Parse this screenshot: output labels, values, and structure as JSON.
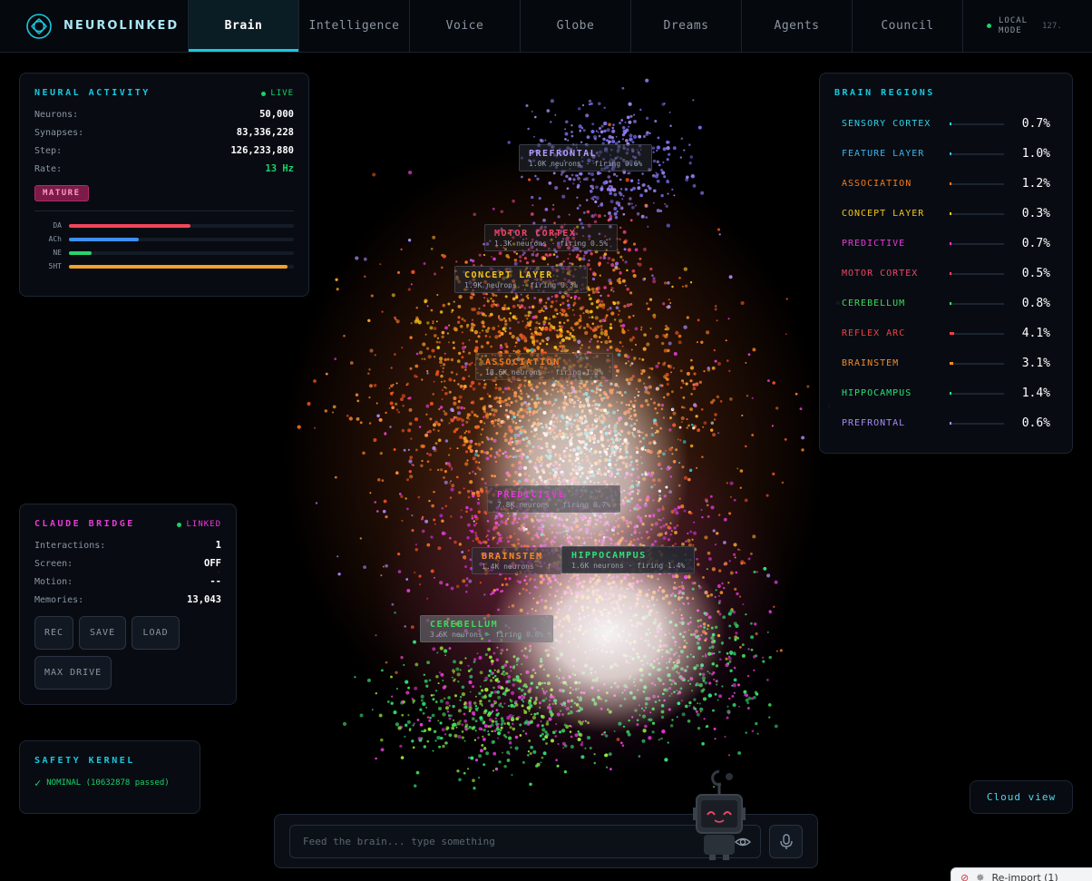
{
  "brand": {
    "name": "NEUROLINKED"
  },
  "nav": {
    "tabs": [
      {
        "label": "Brain",
        "active": true
      },
      {
        "label": "Intelligence"
      },
      {
        "label": "Voice"
      },
      {
        "label": "Globe"
      },
      {
        "label": "Dreams"
      },
      {
        "label": "Agents"
      },
      {
        "label": "Council"
      }
    ],
    "mode_label": "LOCAL MODE",
    "host": "127."
  },
  "neural_activity": {
    "title": "NEURAL ACTIVITY",
    "status": "LIVE",
    "stats": [
      {
        "label": "Neurons:",
        "value": "50,000"
      },
      {
        "label": "Synapses:",
        "value": "83,336,228"
      },
      {
        "label": "Step:",
        "value": "126,233,880"
      },
      {
        "label": "Rate:",
        "value": "13 Hz"
      }
    ],
    "badge": "MATURE",
    "neuromodulators": [
      {
        "label": "DA",
        "level": 0.54,
        "color": "#f0455a"
      },
      {
        "label": "ACh",
        "level": 0.31,
        "color": "#3f8ff5"
      },
      {
        "label": "NE",
        "level": 0.1,
        "color": "#27d36f"
      },
      {
        "label": "5HT",
        "level": 0.97,
        "color": "#f5a02b"
      }
    ]
  },
  "brain_regions": {
    "title": "BRAIN REGIONS",
    "items": [
      {
        "name": "SENSORY CORTEX",
        "pct": "0.7%",
        "value": 0.7,
        "color": "#2cd3ea"
      },
      {
        "name": "FEATURE LAYER",
        "pct": "1.0%",
        "value": 1.0,
        "color": "#38b6f0"
      },
      {
        "name": "ASSOCIATION",
        "pct": "1.2%",
        "value": 1.2,
        "color": "#f57a1f"
      },
      {
        "name": "CONCEPT LAYER",
        "pct": "0.3%",
        "value": 0.3,
        "color": "#f5c518"
      },
      {
        "name": "PREDICTIVE",
        "pct": "0.7%",
        "value": 0.7,
        "color": "#e83ad8"
      },
      {
        "name": "MOTOR CORTEX",
        "pct": "0.5%",
        "value": 0.5,
        "color": "#f0456a"
      },
      {
        "name": "CEREBELLUM",
        "pct": "0.8%",
        "value": 0.8,
        "color": "#3ddc5a"
      },
      {
        "name": "REFLEX ARC",
        "pct": "4.1%",
        "value": 4.1,
        "color": "#f04040"
      },
      {
        "name": "BRAINSTEM",
        "pct": "3.1%",
        "value": 3.1,
        "color": "#f58a2a"
      },
      {
        "name": "HIPPOCAMPUS",
        "pct": "1.4%",
        "value": 1.4,
        "color": "#2ee07a"
      },
      {
        "name": "PREFRONTAL",
        "pct": "0.6%",
        "value": 0.6,
        "color": "#a98af5"
      }
    ]
  },
  "cloud_labels": [
    {
      "name": "PREFRONTAL",
      "sub": "1.0K neurons · firing 0.6%",
      "color": "#b49cff"
    },
    {
      "name": "MOTOR CORTEX",
      "sub": "1.3K neurons · firing 0.5%",
      "color": "#f0456a"
    },
    {
      "name": "CONCEPT LAYER",
      "sub": "1.9K neurons · firing 0.3%",
      "color": "#f5c518"
    },
    {
      "name": "ASSOCIATION",
      "sub": "18.6K neurons · firing 1.2%",
      "color": "#f57a1f"
    },
    {
      "name": "PREDICTIVE",
      "sub": "7.8K neurons · firing 0.7%",
      "color": "#e83ad8"
    },
    {
      "name": "BRAINSTEM",
      "sub": "1.4K neurons · f",
      "color": "#f58a2a"
    },
    {
      "name": "HIPPOCAMPUS",
      "sub": "1.6K neurons · firing 1.4%",
      "color": "#2ee07a"
    },
    {
      "name": "CEREBELLUM",
      "sub": "3.6K neurons · firing 0.8%",
      "color": "#3ddc5a"
    }
  ],
  "claude_bridge": {
    "title": "CLAUDE BRIDGE",
    "status": "LINKED",
    "stats": [
      {
        "label": "Interactions:",
        "value": "1"
      },
      {
        "label": "Screen:",
        "value": "OFF"
      },
      {
        "label": "Motion:",
        "value": "--"
      },
      {
        "label": "Memories:",
        "value": "13,043"
      }
    ],
    "buttons": [
      "REC",
      "SAVE",
      "LOAD",
      "MAX DRIVE"
    ]
  },
  "safety_kernel": {
    "title": "SAFETY KERNEL",
    "status": "NOMINAL (10632878 passed)"
  },
  "cloud_view": {
    "label": "Cloud view"
  },
  "input": {
    "placeholder": "Feed the brain... type something"
  },
  "toast": {
    "text": "Re-import (1)"
  },
  "colors": {
    "accent": "#18c9e0",
    "live": "#19d26a",
    "bridge_title": "#e83ad8",
    "badge": "#7c1a48"
  }
}
